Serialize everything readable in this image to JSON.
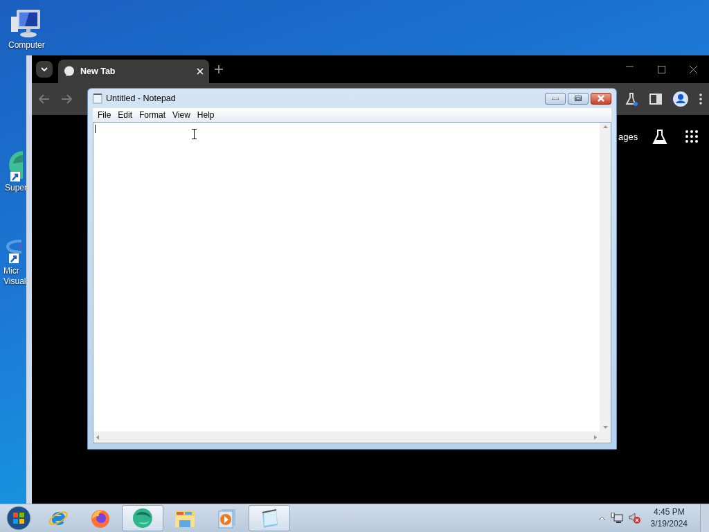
{
  "desktop": {
    "icons": [
      {
        "kind": "computer",
        "lines": [
          "Computer"
        ]
      },
      {
        "kind": "shortcut-green",
        "lines": [
          "Super"
        ]
      },
      {
        "kind": "shortcut-blue",
        "lines": [
          "Micr",
          "Visual"
        ]
      }
    ]
  },
  "browser": {
    "tabs": [
      {
        "title": "New Tab",
        "selected": true
      }
    ],
    "content_text": "ages"
  },
  "notepad": {
    "title": "Untitled - Notepad",
    "menu": [
      "File",
      "Edit",
      "Format",
      "View",
      "Help"
    ]
  },
  "taskbar": {
    "apps": [
      {
        "kind": "ie",
        "selected": false
      },
      {
        "kind": "firefox",
        "selected": false
      },
      {
        "kind": "sphere",
        "selected": true
      },
      {
        "kind": "explorer",
        "selected": false
      },
      {
        "kind": "media",
        "selected": false
      },
      {
        "kind": "notepad",
        "selected": true
      }
    ],
    "time": "4:45 PM",
    "date": "3/19/2024"
  }
}
